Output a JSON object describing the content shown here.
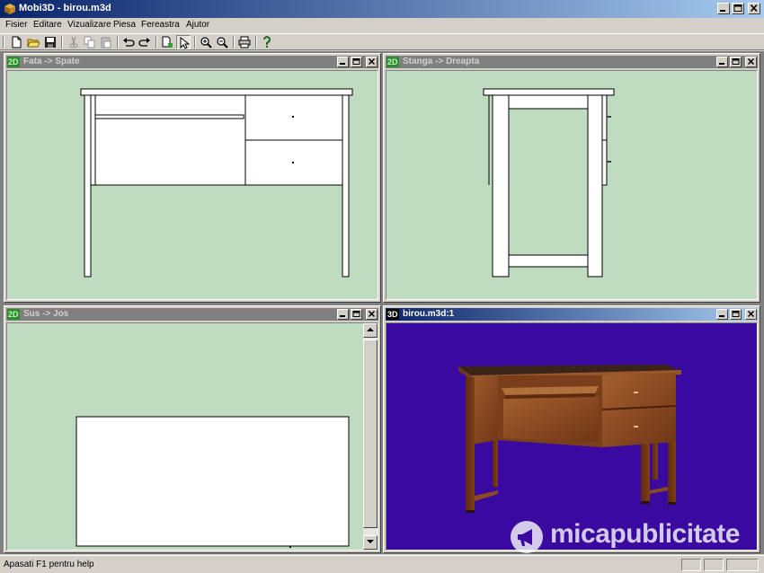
{
  "window": {
    "title": "Mobi3D - birou.m3d",
    "buttons": [
      "minimize-icon",
      "maximize-icon",
      "close-icon"
    ]
  },
  "menu": {
    "items": [
      "Fisier",
      "Editare",
      "Vizualizare",
      "Piesa",
      "Fereastra",
      "Ajutor"
    ]
  },
  "toolbar": {
    "icons": [
      "new-file-icon",
      "open-folder-icon",
      "save-icon",
      "cut-icon",
      "copy-icon",
      "paste-icon",
      "undo-icon",
      "redo-icon",
      "add-piece-icon",
      "select-arrow-icon",
      "zoom-in-icon",
      "zoom-out-icon",
      "print-icon",
      "help-icon"
    ]
  },
  "views": {
    "front": {
      "tag": "2D",
      "title": "Fata -> Spate"
    },
    "side": {
      "tag": "2D",
      "title": "Stanga -> Dreapta"
    },
    "top": {
      "tag": "2D",
      "title": "Sus -> Jos"
    },
    "render3d": {
      "tag": "3D",
      "title": "birou.m3d:1"
    }
  },
  "colors": {
    "view_bg": "#c0dcc0",
    "render_bg": "#3a0aa0",
    "wood": "#8a4a22",
    "active_caption": "#0a246a"
  },
  "status": {
    "text": "Apasati  F1 pentru help"
  },
  "watermark": {
    "text": "micapublicitate"
  }
}
